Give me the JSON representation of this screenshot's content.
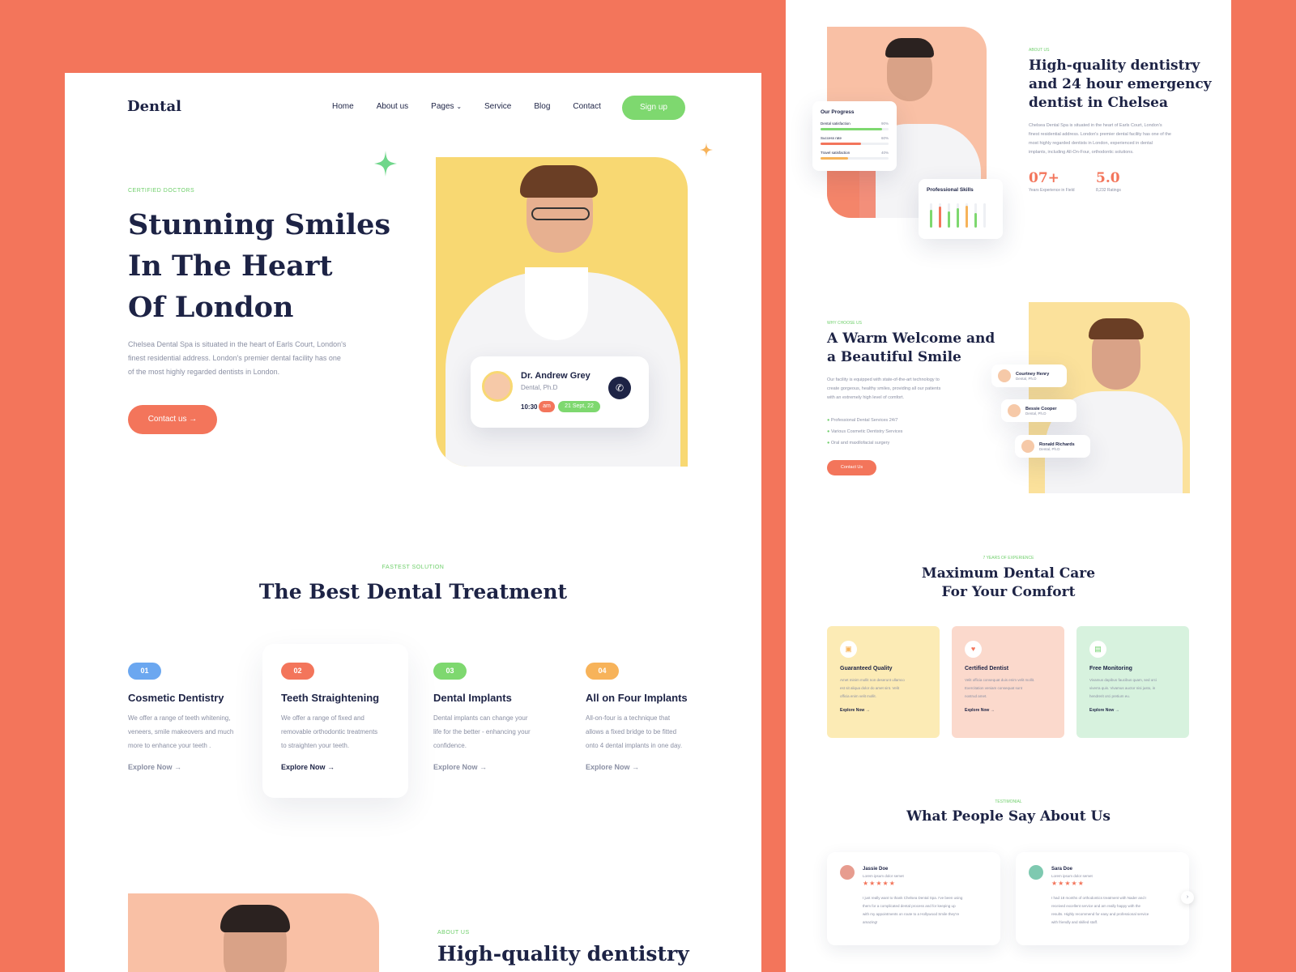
{
  "left": {
    "brand": "Dental",
    "nav": [
      "Home",
      "About us",
      "Pages",
      "Service",
      "Blog",
      "Contact"
    ],
    "signup": "Sign up",
    "hero": {
      "eyebrow": "CERTIFIED DOCTORS",
      "title_lines": [
        "Stunning Smiles",
        "In The Heart",
        "Of London"
      ],
      "desc_lines": [
        "Chelsea Dental Spa is situated in the heart of Earls Court, London's",
        "finest residential address. London's premier dental facility has one",
        "of the most highly regarded dentists in London."
      ],
      "cta": "Contact us"
    },
    "doctor_card": {
      "name": "Dr. Andrew Grey",
      "title": "Dental, Ph.D",
      "time": "10:30",
      "ampm": "am",
      "date": "21 Sept, 22"
    },
    "treatment": {
      "eyebrow": "FASTEST SOLUTION",
      "title": "The Best Dental Treatment",
      "items": [
        {
          "num": "01",
          "title": "Cosmetic Dentistry",
          "lines": [
            "We offer a range of teeth whitening,",
            "veneers, smile makeovers and much",
            "more to enhance your teeth ."
          ],
          "link": "Explore Now"
        },
        {
          "num": "02",
          "title": "Teeth Straightening",
          "lines": [
            "We offer a range of fixed and",
            "removable orthodontic treatments",
            "to straighten your teeth."
          ],
          "link": "Explore Now"
        },
        {
          "num": "03",
          "title": "Dental Implants",
          "lines": [
            "Dental implants can change your",
            "life for the better - enhancing your",
            "confidence."
          ],
          "link": "Explore Now"
        },
        {
          "num": "04",
          "title": "All on Four Implants",
          "lines": [
            "All-on-four is a technique that",
            "allows a fixed bridge to be fitted",
            "onto 4 dental implants in one day."
          ],
          "link": "Explore Now"
        }
      ]
    },
    "about": {
      "eyebrow": "ABOUT US",
      "title": "High-quality dentistry"
    }
  },
  "right": {
    "progress": {
      "title": "Our Progress",
      "bars": [
        {
          "label": "Dental satisfaction",
          "value": "90%",
          "fraction": 0.9
        },
        {
          "label": "Success rate",
          "value": "60%",
          "fraction": 0.6
        },
        {
          "label": "Travel satisfaction",
          "value": "40%",
          "fraction": 0.4
        }
      ]
    },
    "skills_title": "Professional Skills",
    "about": {
      "eyebrow": "ABOUT US",
      "title_lines": [
        "High-quality dentistry",
        "and 24 hour emergency",
        "dentist in Chelsea"
      ],
      "desc_lines": [
        "Chelsea Dental Spa is situated in the heart of Earls Court, London's",
        "finest residential address. London's premier dental facility has one of the",
        "most highly regarded dentists in London, experienced in dental",
        "implants, including All-On-Four, orthodontic solutions."
      ],
      "stats": [
        {
          "value": "07+",
          "label": "Years Experience in Field"
        },
        {
          "value": "5.0",
          "label": "8,232 Ratings"
        }
      ]
    },
    "why": {
      "eyebrow": "WHY CHOOSE US",
      "title_lines": [
        "A Warm Welcome and",
        "a Beautiful Smile"
      ],
      "desc_lines": [
        "Our facility is equipped with state-of-the-art technology to",
        "create gorgeous, healthy smiles, providing all our patients",
        "with an extremely high level of comfort."
      ],
      "checks": [
        "Professional Dental Services 24/7",
        "Various Cosmetic Dentistry Services",
        "Oral and maxillofacial surgery"
      ],
      "cta": "Contact Us",
      "people": [
        {
          "name": "Courtney Henry",
          "role": "Dental, Ph.D"
        },
        {
          "name": "Bessie Cooper",
          "role": "Dental, Ph.D"
        },
        {
          "name": "Ronald Richards",
          "role": "Dental, Ph.D"
        }
      ]
    },
    "care": {
      "eyebrow": "7 YEARS OF EXPERIENCE",
      "title_lines": [
        "Maximum Dental Care",
        "For Your Comfort"
      ],
      "cards": [
        {
          "title": "Guaranteed Quality",
          "lines": [
            "Amet minim mollit non deserunt ullamco",
            "est sit aliqua dolor do amet sint. Velit",
            "officia enim velit mollit."
          ],
          "link": "Explore Now",
          "bg": "#FCEBB5"
        },
        {
          "title": "Certified Dentist",
          "lines": [
            "Velit officia consequat duis enim velit mollit.",
            "Exercitation veniam consequat sunt",
            "nostrud amet."
          ],
          "link": "Explore Now",
          "bg": "#FBD9CC"
        },
        {
          "title": "Free Monitoring",
          "lines": [
            "Vivamus dapibus faucibus quam, sed orci",
            "viverra quis. Vivamus auctor nisi justo, in",
            "hendrerit orci pretium eu."
          ],
          "link": "Explore Now",
          "bg": "#D7F2DE"
        }
      ]
    },
    "testimonial": {
      "eyebrow": "TESTIMONIAL",
      "title": "What People Say About Us",
      "items": [
        {
          "name": "Jassie Doe",
          "sub": "Lorem ipsum dolor semet",
          "lines": [
            "I just really want to thank Chelsea Dental Spa. I've been using",
            "them for a complicated dental process and for keeping up",
            "with my appointments on route to a Hollywood Smile they're",
            "amazing!"
          ]
        },
        {
          "name": "Sara Doe",
          "sub": "Lorem ipsum dolor semet",
          "lines": [
            "I had 18 months of orthodontics treatment with Nader and I",
            "received excellent service and am really happy with the",
            "results. Highly recommend for easy and professional service",
            "with friendly and skilled staff."
          ]
        }
      ]
    }
  }
}
